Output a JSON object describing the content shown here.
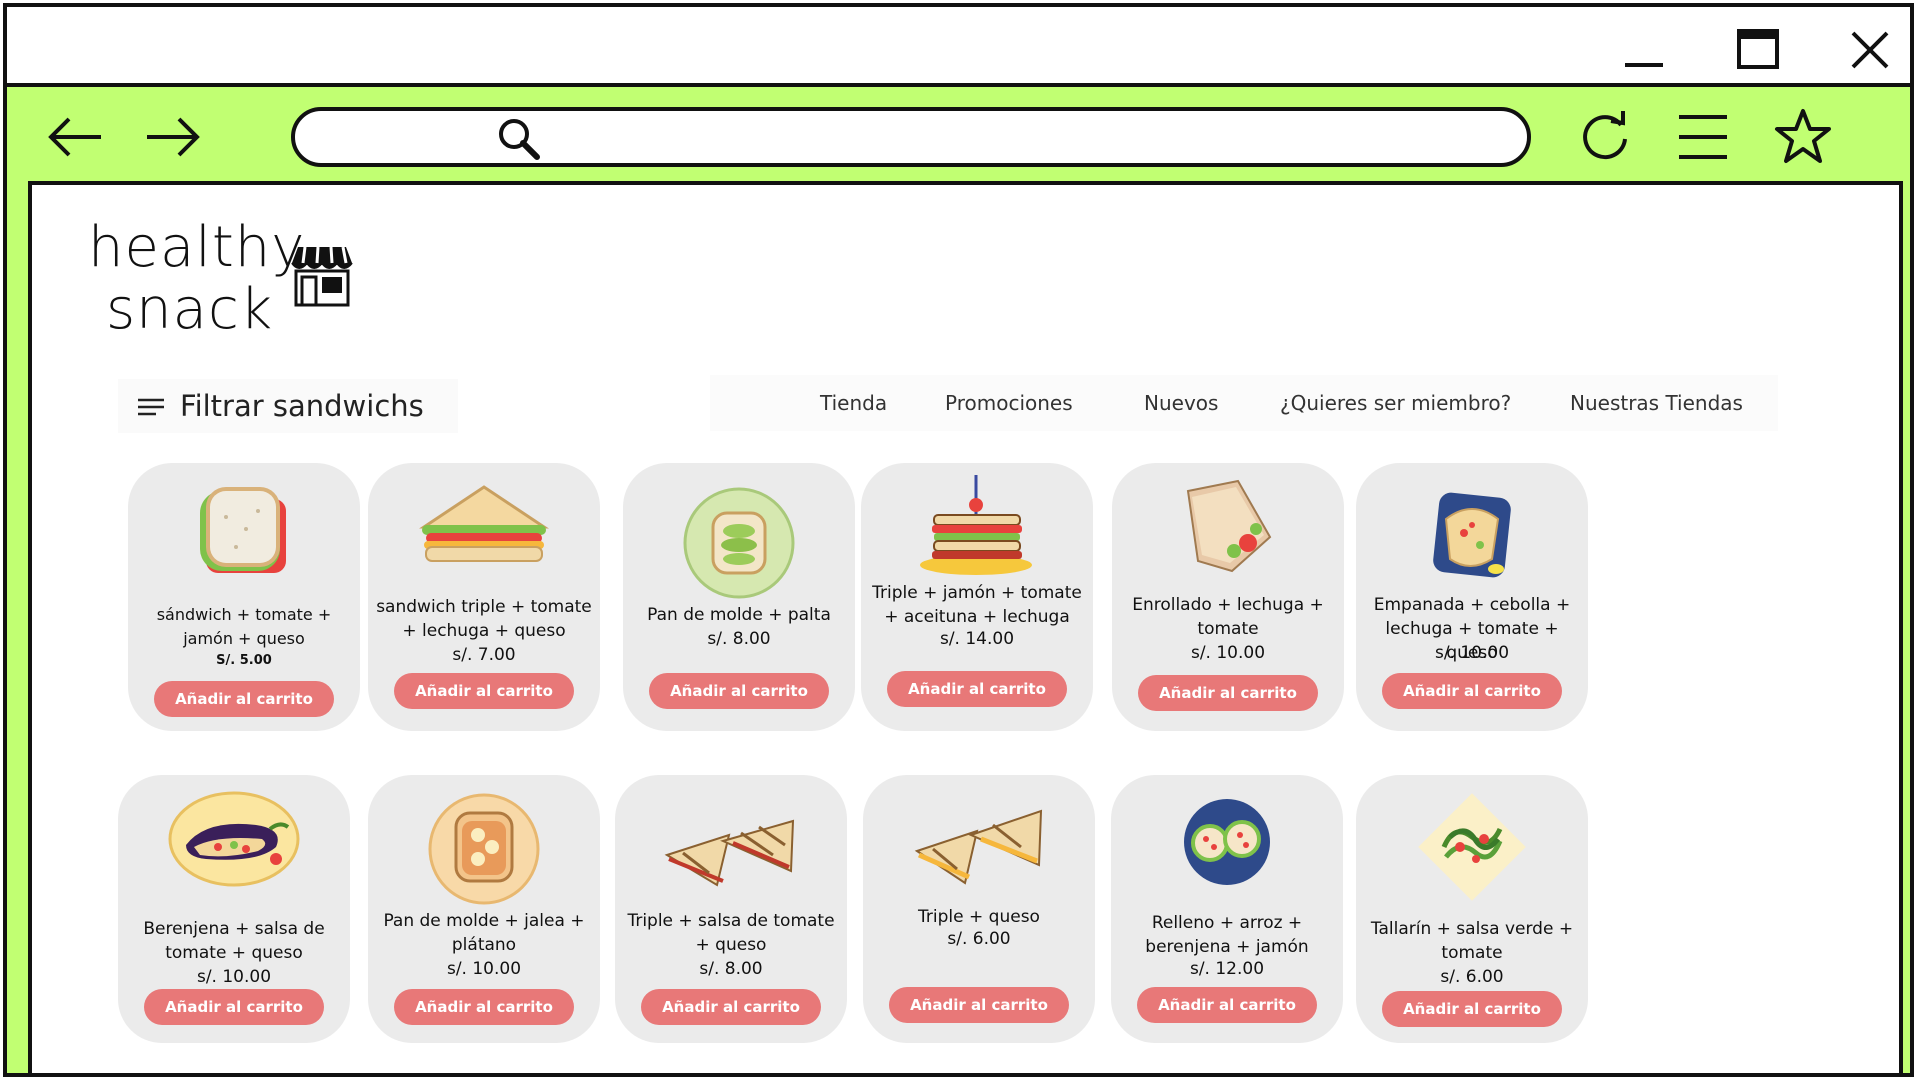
{
  "browser": {
    "address_placeholder": ""
  },
  "header": {
    "logo_line1": "healthy",
    "logo_line2": "snack"
  },
  "filter": {
    "label": "Filtrar sandwichs"
  },
  "tabs": [
    {
      "label": "Tienda"
    },
    {
      "label": "Promociones"
    },
    {
      "label": "Nuevos"
    },
    {
      "label": "¿Quieres ser miembro?"
    },
    {
      "label": "Nuestras Tiendas"
    }
  ],
  "products": [
    {
      "name": "sándwich + tomate + jamón + queso",
      "price": "S/. 5.00",
      "button": "Añadir al carrito",
      "image": "sandwich-slice-icon"
    },
    {
      "name": "sandwich triple + tomate + lechuga + queso",
      "price": "s/. 7.00",
      "button": "Añadir al carrito",
      "image": "triangle-sandwich-icon"
    },
    {
      "name": "Pan de molde + palta",
      "price": "s/. 8.00",
      "button": "Añadir al carrito",
      "image": "avocado-toast-icon"
    },
    {
      "name": "Triple + jamón + tomate + aceituna + lechuga",
      "price": "s/. 14.00",
      "button": "Añadir al carrito",
      "image": "club-sandwich-icon"
    },
    {
      "name": "Enrollado + lechuga + tomate",
      "price": "s/. 10.00",
      "button": "Añadir al carrito",
      "image": "wrap-icon"
    },
    {
      "name": "Empanada + cebolla + lechuga + tomate + queso",
      "price": "s/. 10.00",
      "button": "Añadir al carrito",
      "image": "quesadilla-icon"
    },
    {
      "name": "Berenjena + salsa de tomate + queso",
      "price": "s/. 10.00",
      "button": "Añadir al carrito",
      "image": "eggplant-icon"
    },
    {
      "name": "Pan de molde + jalea + plátano",
      "price": "s/. 10.00",
      "button": "Añadir al carrito",
      "image": "banana-toast-icon"
    },
    {
      "name": "Triple + salsa de tomate + queso",
      "price": "s/. 8.00",
      "button": "Añadir al carrito",
      "image": "grilled-sandwich-icon"
    },
    {
      "name": "Triple + queso",
      "price": "s/. 6.00",
      "button": "Añadir al carrito",
      "image": "cheese-toastie-icon"
    },
    {
      "name": "Relleno + arroz + berenjena + jamón",
      "price": "s/. 12.00",
      "button": "Añadir al carrito",
      "image": "stuffed-peppers-icon"
    },
    {
      "name": "Tallarín + salsa verde + tomate",
      "price": "s/. 6.00",
      "button": "Añadir al carrito",
      "image": "green-noodles-icon"
    }
  ],
  "colors": {
    "accent": "#c1ff72",
    "button": "#e87878",
    "card": "#ebebeb"
  }
}
